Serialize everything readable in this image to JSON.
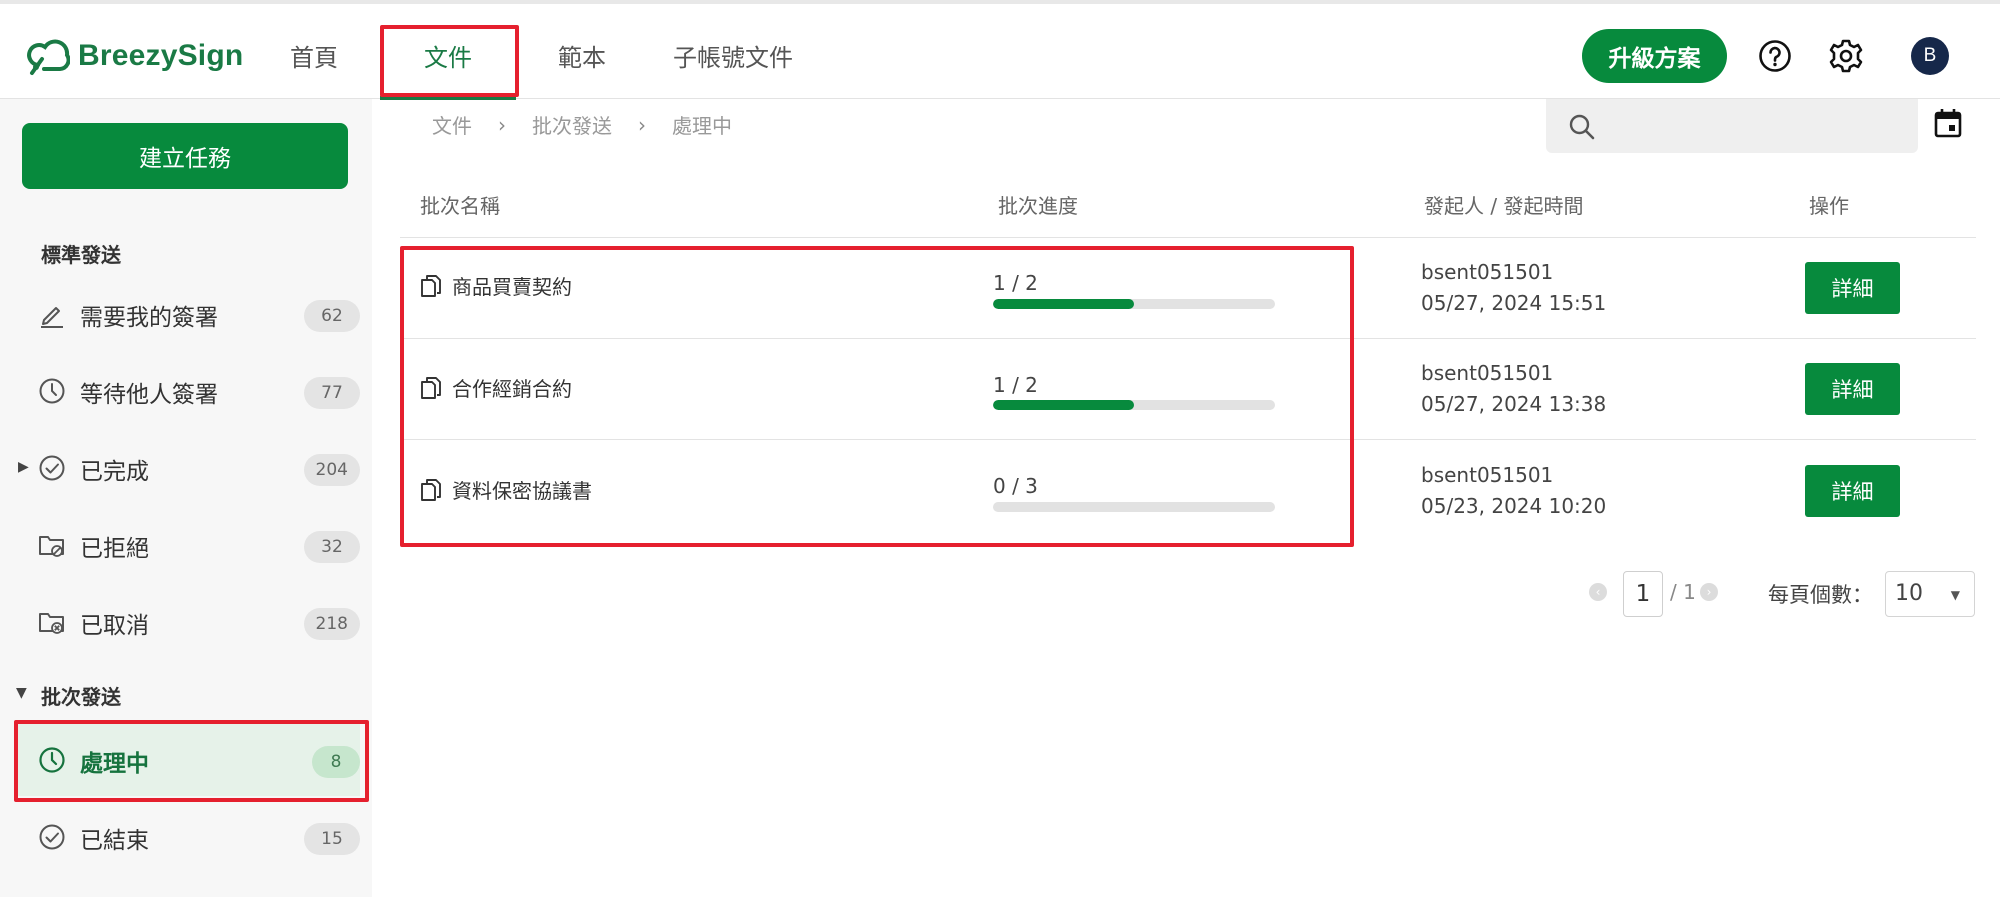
{
  "brand": {
    "name": "BreezySign"
  },
  "nav": [
    {
      "label": "首頁"
    },
    {
      "label": "文件"
    },
    {
      "label": "範本"
    },
    {
      "label": "子帳號文件"
    }
  ],
  "header": {
    "upgrade_label": "升級方案",
    "avatar_initial": "B"
  },
  "sidebar": {
    "create_label": "建立任務",
    "standard_section": "標準發送",
    "batch_section": "批次發送",
    "items": [
      {
        "label": "需要我的簽署",
        "count": "62",
        "icon": "pen-icon"
      },
      {
        "label": "等待他人簽署",
        "count": "77",
        "icon": "clock-icon"
      },
      {
        "label": "已完成",
        "count": "204",
        "icon": "check-circle-icon"
      },
      {
        "label": "已拒絕",
        "count": "32",
        "icon": "folder-reject-icon"
      },
      {
        "label": "已取消",
        "count": "218",
        "icon": "folder-cancel-icon"
      }
    ],
    "batch_items": [
      {
        "label": "處理中",
        "count": "8",
        "icon": "clock-icon",
        "active": true
      },
      {
        "label": "已結束",
        "count": "15",
        "icon": "check-circle-icon"
      }
    ]
  },
  "breadcrumb": [
    "文件",
    "批次發送",
    "處理中"
  ],
  "table": {
    "headers": [
      "批次名稱",
      "批次進度",
      "發起人 / 發起時間",
      "操作"
    ],
    "rows": [
      {
        "name": "商品買賣契約",
        "progress_text": "1 / 2",
        "progress": 0.5,
        "sender": "bsent051501",
        "time": "05/27, 2024 15:51",
        "action": "詳細"
      },
      {
        "name": "合作經銷合約",
        "progress_text": "1 / 2",
        "progress": 0.5,
        "sender": "bsent051501",
        "time": "05/27, 2024 13:38",
        "action": "詳細"
      },
      {
        "name": "資料保密協議書",
        "progress_text": "0 / 3",
        "progress": 0.0,
        "sender": "bsent051501",
        "time": "05/23, 2024 10:20",
        "action": "詳細"
      }
    ]
  },
  "pagination": {
    "current": "1",
    "total": "/ 1",
    "per_page_label": "每頁個數：",
    "per_page": "10"
  },
  "colors": {
    "brand_green": "#078a3d",
    "highlight_red": "#e5202e",
    "active_bg": "#e6f2e9"
  }
}
